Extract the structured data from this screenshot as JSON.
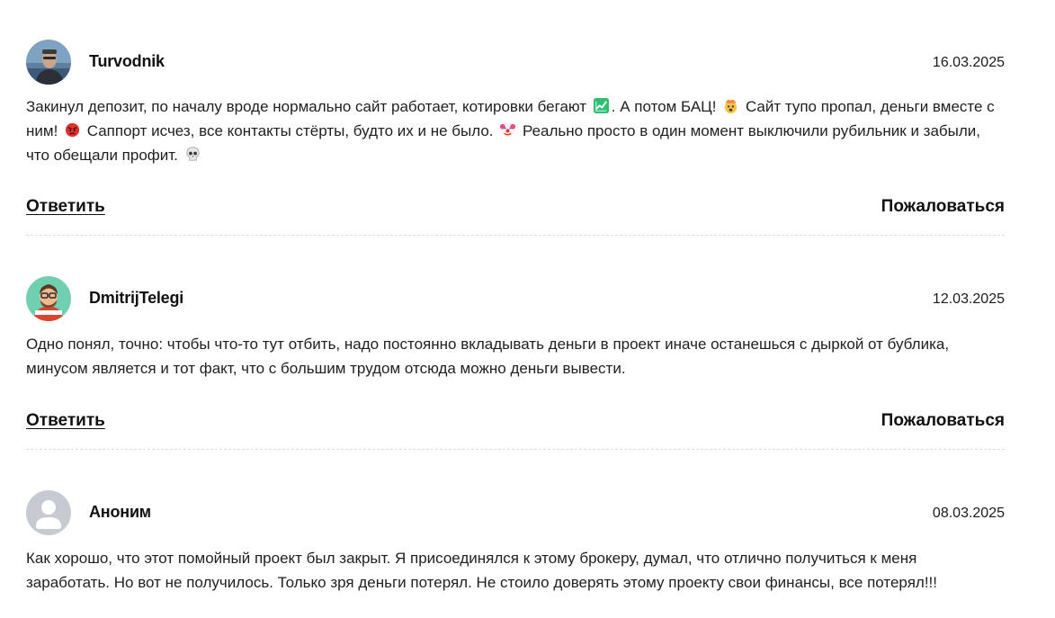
{
  "comments": [
    {
      "author": "Turvodnik",
      "date": "16.03.2025",
      "text_parts": [
        "Закинул депозит, по началу вроде нормально сайт работает, котировки бегают",
        ". А потом БАЦ!",
        " Сайт тупо пропал, деньги вместе с ним!",
        " Саппорт исчез, все контакты стёрты, будто их и не было.",
        " Реально просто в один момент выключили рубильник и забыли, что обещали профит."
      ],
      "emojis": [
        "chart-increasing-emoji",
        "exploding-head-emoji",
        "angry-face-emoji",
        "clown-face-emoji",
        "skull-emoji"
      ],
      "avatar": "photo-avatar",
      "reply_label": "Ответить",
      "report_label": "Пожаловаться"
    },
    {
      "author": "DmitrijTelegi",
      "date": "12.03.2025",
      "text": "Одно понял, точно: чтобы что-то тут отбить, надо постоянно вкладывать деньги в проект иначе останешься с дыркой от бублика, минусом является и тот факт, что с большим трудом отсюда можно деньги вывести.",
      "avatar": "cartoon-avatar",
      "reply_label": "Ответить",
      "report_label": "Пожаловаться"
    },
    {
      "author": "Аноним",
      "date": "08.03.2025",
      "text": "Как хорошо, что этот помойный проект был закрыт. Я присоединялся к этому брокеру, думал, что отлично получиться к меня заработать. Но вот не получилось. Только зря деньги потерял. Не стоило доверять этому проекту свои финансы, все потерял!!!",
      "avatar": "default-user-avatar"
    }
  ],
  "colors": {
    "text": "#1f1f1f",
    "divider": "#dcdcdc",
    "anon_avatar": "#c7cbd1",
    "emoji_green": "#2fbf71",
    "emoji_red": "#e0312f"
  }
}
